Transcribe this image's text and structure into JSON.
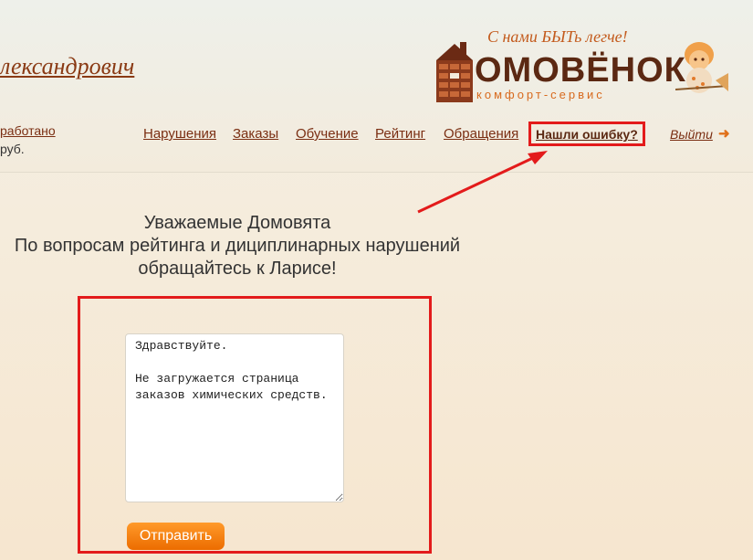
{
  "user": {
    "name_fragment": "лександрович",
    "earned_label": "работано",
    "currency": "руб."
  },
  "logo": {
    "tagline": "С нами БЫТь легче!",
    "name": "ОМОВЁНОК",
    "subtitle": "комфорт-сервис"
  },
  "nav": {
    "items": [
      "Нарушения",
      "Заказы",
      "Обучение",
      "Рейтинг",
      "Обращения"
    ],
    "found_error": "Нашли ошибку?",
    "logout": "Выйти",
    "logout_arrow": "➜"
  },
  "notice": {
    "line1": "Уважаемые Домовята",
    "line2": "По вопросам рейтинга и дициплинарных нарушений",
    "line3": "обращайтесь к Ларисе!"
  },
  "feedback": {
    "message": "Здравствуйте.\n\nНе загружается страница заказов химических средств. ",
    "send_label": "Отправить"
  },
  "colors": {
    "accent": "#ec6c00",
    "annotation": "#e31b1b",
    "link": "#7a2e12"
  }
}
